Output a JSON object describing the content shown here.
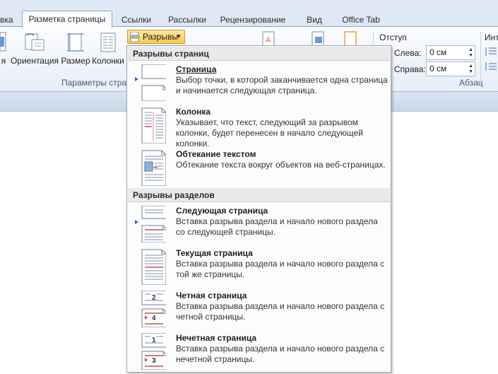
{
  "tabs": [
    {
      "label": "вка",
      "active": false
    },
    {
      "label": "Разметка страницы",
      "active": true
    },
    {
      "label": "Ссылки",
      "active": false
    },
    {
      "label": "Рассылки",
      "active": false
    },
    {
      "label": "Рецензирование",
      "active": false
    },
    {
      "label": "Вид",
      "active": false
    },
    {
      "label": "Office Tab",
      "active": false
    }
  ],
  "ribbon": {
    "orientation_label": "Ориентация",
    "size_label": "Размер",
    "columns_label": "Колонки",
    "truncated_label": "я",
    "breaks_label": "Разрывы",
    "page_setup_group": "Параметры стран",
    "paragraph_group": "Абзац",
    "indent": {
      "title": "Отступ",
      "left_label": "Слева:",
      "left_value": "0 см",
      "right_label": "Справа:",
      "right_value": "0 см"
    },
    "spacing_truncated": "Инт"
  },
  "menu": {
    "page_breaks_header": "Разрывы страниц",
    "section_breaks_header": "Разрывы разделов",
    "page_breaks": [
      {
        "title": "Страница",
        "desc": "Выбор точки, в которой заканчивается одна страница и начинается следующая страница.",
        "icon": "page-break-icon"
      },
      {
        "title": "Колонка",
        "desc": "Указывает, что текст, следующий за разрывом колонки, будет перенесен в начало следующей колонки.",
        "icon": "column-break-icon"
      },
      {
        "title": "Обтекание текстом",
        "desc": "Обтекание текста вокруг объектов на веб-страницах.",
        "icon": "text-wrapping-icon"
      }
    ],
    "section_breaks": [
      {
        "title": "Следующая страница",
        "desc": "Вставка разрыва раздела и начало нового раздела со следующей страницы.",
        "icon": "next-page-icon"
      },
      {
        "title": "Текущая страница",
        "desc": "Вставка разрыва раздела и начало нового раздела с той же страницы.",
        "icon": "continuous-icon"
      },
      {
        "title": "Четная страница",
        "desc": "Вставка разрыва раздела и начало нового раздела с четной страницы.",
        "icon": "even-page-icon",
        "badge_top": "2",
        "badge_bottom": "4"
      },
      {
        "title": "Нечетная страница",
        "desc": "Вставка разрыва раздела и начало нового раздела с нечетной страницы.",
        "icon": "odd-page-icon",
        "badge_top": "1",
        "badge_bottom": "3"
      }
    ]
  },
  "colors": {
    "accent": "#c0504d",
    "ribbon_bg": "#dfe9f5",
    "highlight": "#f9c94e"
  }
}
